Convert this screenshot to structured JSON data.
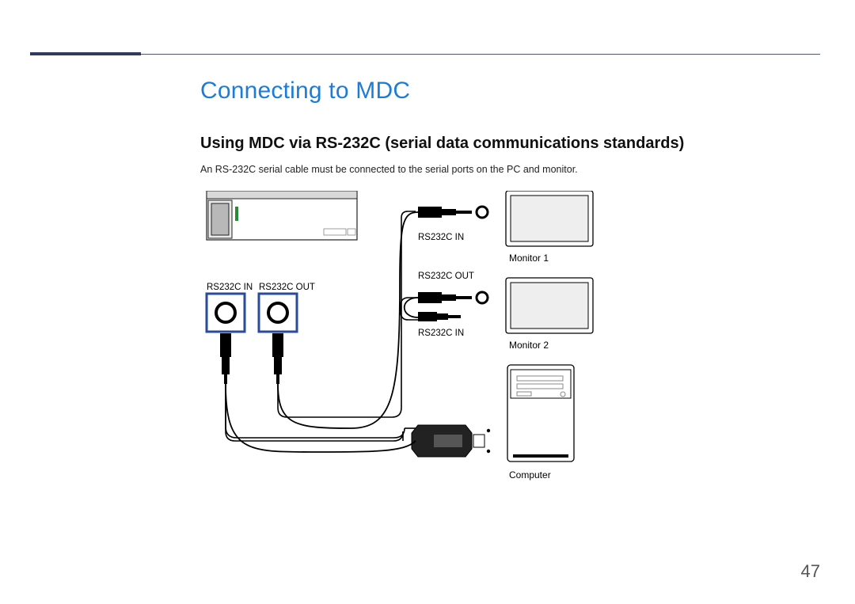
{
  "page": {
    "title": "Connecting to MDC",
    "subtitle": "Using MDC via RS-232C (serial data communications standards)",
    "description": "An RS-232C serial cable must be connected to the serial ports on the PC and monitor.",
    "number": "47"
  },
  "labels": {
    "port_in_left": "RS232C IN",
    "port_out_left": "RS232C OUT",
    "conn_in_top": "RS232C IN",
    "conn_out_mid": "RS232C OUT",
    "conn_in_bot": "RS232C IN",
    "monitor1": "Monitor 1",
    "monitor2": "Monitor 2",
    "computer": "Computer"
  },
  "colors": {
    "accent": "#1c7cd6",
    "port_frame": "#2a4b9b"
  }
}
